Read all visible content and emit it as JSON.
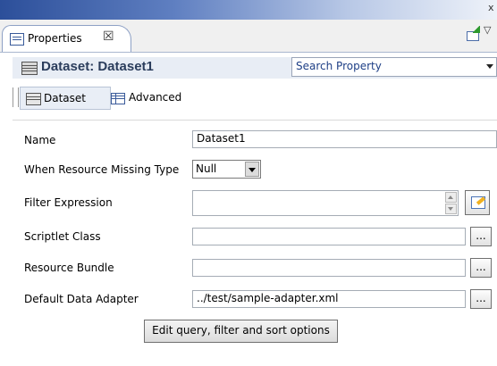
{
  "view": {
    "tab_label": "Properties",
    "close_icon": "close-icon",
    "viewmenu_icon": "view-menu-icon"
  },
  "header": {
    "title": "Dataset: Dataset1",
    "search_placeholder": "Search Property"
  },
  "page_tabs": [
    {
      "label": "Dataset",
      "selected": true
    },
    {
      "label": "Advanced",
      "selected": false
    }
  ],
  "form": {
    "name_label": "Name",
    "name_value": "Dataset1",
    "missing_label": "When Resource Missing Type",
    "missing_value": "Null",
    "filter_label": "Filter Expression",
    "filter_value": "",
    "scriptlet_label": "Scriptlet Class",
    "scriptlet_value": "",
    "bundle_label": "Resource Bundle",
    "bundle_value": "",
    "adapter_label": "Default Data Adapter",
    "adapter_value": "../test/sample-adapter.xml",
    "browse_label": "...",
    "edit_query_label": "Edit query, filter and sort options"
  }
}
